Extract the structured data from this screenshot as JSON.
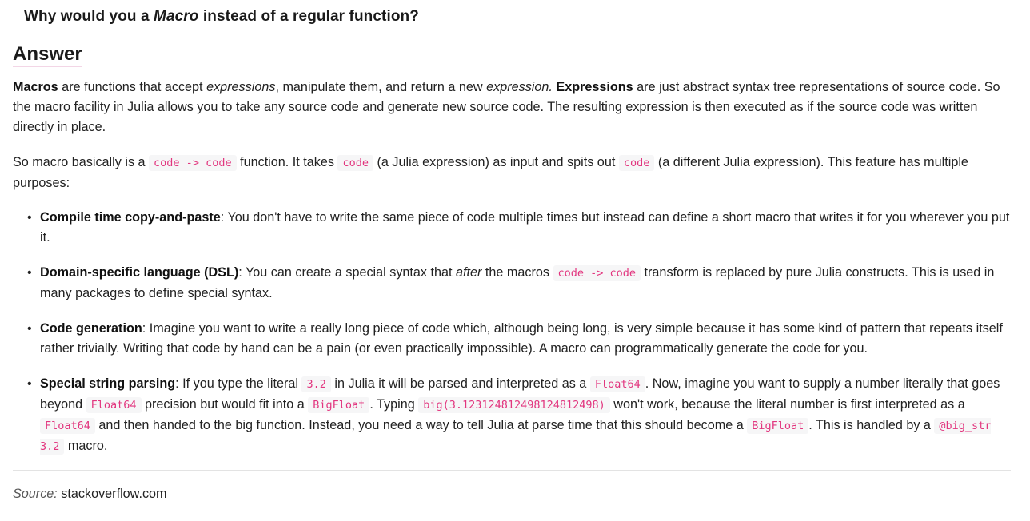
{
  "question": {
    "part1": "Why would you a ",
    "emphasis": "Macro",
    "part2": " instead of a regular function?"
  },
  "answer_heading": "Answer",
  "paragraph1": {
    "t1": "Macros",
    "t2": " are functions that accept ",
    "t3": "expressions",
    "t4": ", manipulate them, and return a new ",
    "t5": "expression.",
    "t6": " ",
    "t7": "Expressions",
    "t8": " are just abstract syntax tree representations of source code. So the macro facility in Julia allows you to take any source code and generate new source code. The resulting expression is then executed as if the source code was written directly in place."
  },
  "paragraph2": {
    "t1": "So macro basically is a ",
    "c1": "code -> code",
    "t2": " function. It takes ",
    "c2": "code",
    "t3": " (a Julia expression) as input and spits out ",
    "c3": "code",
    "t4": " (a different Julia expression). This feature has multiple purposes:"
  },
  "items": {
    "i1": {
      "title": "Compile time copy-and-paste",
      "t1": ": You don't have to write the same piece of code multiple times but instead can define a short macro that writes it for you wherever you put it."
    },
    "i2": {
      "title": "Domain-specific language (DSL)",
      "t1": ": You can create a special syntax that ",
      "em": "after",
      "t2": " the macros ",
      "c1": "code -> code",
      "t3": " transform is replaced by pure Julia constructs. This is used in many packages to define special syntax."
    },
    "i3": {
      "title": "Code generation",
      "t1": ": Imagine you want to write a really long piece of code which, although being long, is very simple because it has some kind of pattern that repeats itself rather trivially. Writing that code by hand can be a pain (or even practically impossible). A macro can programmatically generate the code for you."
    },
    "i4": {
      "title": "Special string parsing",
      "t1": ": If you type the literal ",
      "c1": "3.2",
      "t2": " in Julia it will be parsed and interpreted as a ",
      "c2": "Float64",
      "t3": ". Now, imagine you want to supply a number literally that goes beyond ",
      "c3": "Float64",
      "t4": " precision but would fit into a ",
      "c4": "BigFloat",
      "t5": ". Typing ",
      "c5": "big(3.123124812498124812498)",
      "t6": " won't work, because the literal number is first interpreted as a ",
      "c6": "Float64",
      "t7": " and then handed to the big function. Instead, you need a way to tell Julia at parse time that this should become a ",
      "c7": "BigFloat",
      "t8": ". This is handled by a ",
      "c8": "@big_str 3.2",
      "t9": " macro."
    }
  },
  "bullet": "•",
  "source": {
    "label": "Source:",
    "space": " ",
    "value": "stackoverflow.com"
  }
}
